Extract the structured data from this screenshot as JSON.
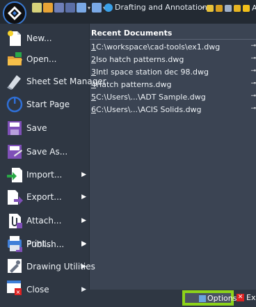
{
  "topbar": {
    "workspace": "Drafting and Annotation",
    "right_text": "A"
  },
  "menu": {
    "items": [
      {
        "label": "New...",
        "icon": "new-file-icon",
        "has_submenu": false
      },
      {
        "label": "Open...",
        "icon": "open-folder-icon",
        "has_submenu": false
      },
      {
        "label": "Sheet Set Manager",
        "icon": "sheet-set-icon",
        "has_submenu": false
      },
      {
        "label": "Start Page",
        "icon": "start-page-icon",
        "has_submenu": false
      },
      {
        "label": "Save",
        "icon": "save-icon",
        "has_submenu": false
      },
      {
        "label": "Save As...",
        "icon": "save-as-icon",
        "has_submenu": false
      },
      {
        "label": "Import...",
        "icon": "import-icon",
        "has_submenu": true
      },
      {
        "label": "Export...",
        "icon": "export-icon",
        "has_submenu": true
      },
      {
        "label": "Attach...",
        "icon": "attach-icon",
        "has_submenu": true
      },
      {
        "label": "Publish...",
        "icon": "publish-icon",
        "has_submenu": true
      },
      {
        "label": "Print...",
        "icon": "print-icon",
        "has_submenu": true
      },
      {
        "label": "Drawing Utilities",
        "icon": "utilities-icon",
        "has_submenu": true
      },
      {
        "label": "Close",
        "icon": "close-icon",
        "has_submenu": true
      }
    ]
  },
  "recent": {
    "heading": "Recent Documents",
    "docs": [
      {
        "num": "1",
        "name": " C:\\workspace\\cad-tools\\ex1.dwg"
      },
      {
        "num": "2",
        "name": " Iso hatch patterns.dwg"
      },
      {
        "num": "3",
        "name": " Intl space station dec 98.dwg"
      },
      {
        "num": "4",
        "name": " Hatch patterns.dwg"
      },
      {
        "num": "5",
        "name": " C:\\Users\\...\\ADT Sample.dwg"
      },
      {
        "num": "6",
        "name": " C:\\Users\\...\\ACIS Solids.dwg"
      }
    ]
  },
  "footer": {
    "options_label": "Options...",
    "exit_label": "Exit"
  }
}
